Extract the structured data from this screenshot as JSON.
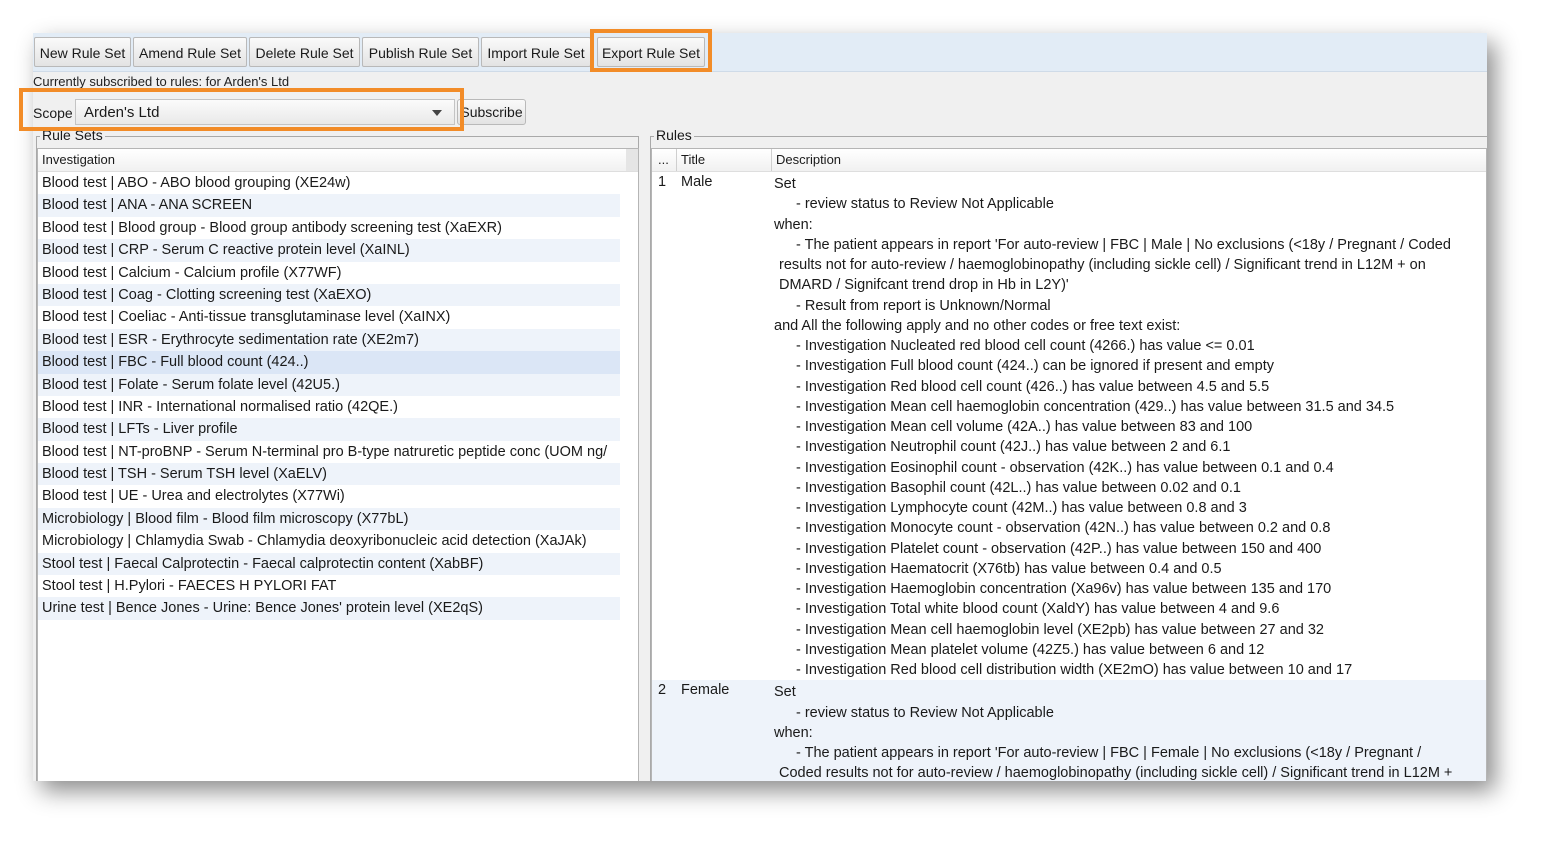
{
  "toolbar": {
    "buttons": [
      "New Rule Set",
      "Amend Rule Set",
      "Delete Rule Set",
      "Publish Rule Set",
      "Import Rule Set",
      "Export Rule Set"
    ]
  },
  "subscription": {
    "text": "Currently subscribed to rules: for  Arden's Ltd"
  },
  "scope": {
    "label": "Scope",
    "value": "Arden's Ltd",
    "subscribe_label": "Subscribe"
  },
  "rule_sets": {
    "group_title": "Rule Sets",
    "column_header": "Investigation",
    "items": [
      "Blood test | ABO - ABO blood grouping (XE24w)",
      "Blood test | ANA - ANA SCREEN",
      "Blood test | Blood group - Blood group antibody screening test (XaEXR)",
      "Blood test | CRP - Serum C reactive protein level (XaINL)",
      "Blood test | Calcium - Calcium profile (X77WF)",
      "Blood test | Coag - Clotting screening test (XaEXO)",
      "Blood test | Coeliac - Anti-tissue transglutaminase level (XaINX)",
      "Blood test | ESR - Erythrocyte sedimentation rate (XE2m7)",
      "Blood test | FBC - Full blood count (424..)",
      "Blood test | Folate - Serum folate level (42U5.)",
      "Blood test | INR - International normalised ratio (42QE.)",
      "Blood test | LFTs - Liver profile",
      "Blood test | NT-proBNP - Serum N-terminal pro B-type natruretic peptide conc (UOM ng/",
      "Blood test | TSH - Serum TSH level (XaELV)",
      "Blood test | UE - Urea and electrolytes (X77Wi)",
      "Microbiology | Blood film - Blood film microscopy (X77bL)",
      "Microbiology | Chlamydia Swab - Chlamydia deoxyribonucleic acid detection (XaJAk)",
      "Stool test | Faecal Calprotectin - Faecal calprotectin content (XabBF)",
      "Stool test | H.Pylori - FAECES H PYLORI FAT",
      "Urine test | Bence Jones - Urine: Bence Jones' protein level (XE2qS)"
    ],
    "selected_index": 8
  },
  "rules": {
    "group_title": "Rules",
    "columns": [
      "...",
      "Title",
      "Description"
    ],
    "rows": [
      {
        "num": "1",
        "title": "Male",
        "description": [
          {
            "text": "Set",
            "indent": 0
          },
          {
            "text": "- review status to Review Not Applicable",
            "indent": 1
          },
          {
            "text": "when:",
            "indent": 0
          },
          {
            "text": "- The patient appears in report 'For auto-review | FBC | Male | No exclusions (<18y / Pregnant / Coded",
            "indent": 1
          },
          {
            "text": "results not for auto-review / haemoglobinopathy (including sickle cell) / Significant trend in L12M + on",
            "indent": 2
          },
          {
            "text": "DMARD / Signifcant trend drop in Hb in L2Y)'",
            "indent": 2
          },
          {
            "text": "- Result from report is Unknown/Normal",
            "indent": 1
          },
          {
            "text": "and All the following apply and no other codes or free text exist:",
            "indent": 0
          },
          {
            "text": "- Investigation Nucleated red blood cell count (4266.) has value <= 0.01",
            "indent": 1
          },
          {
            "text": "- Investigation Full blood count (424..) can be ignored if present and empty",
            "indent": 1
          },
          {
            "text": "- Investigation Red blood cell count (426..) has value between 4.5 and 5.5",
            "indent": 1
          },
          {
            "text": "- Investigation Mean cell haemoglobin concentration (429..) has value between 31.5 and 34.5",
            "indent": 1
          },
          {
            "text": "- Investigation Mean cell volume (42A..) has value between 83 and 100",
            "indent": 1
          },
          {
            "text": "- Investigation Neutrophil count (42J..) has value between 2 and 6.1",
            "indent": 1
          },
          {
            "text": "- Investigation Eosinophil count - observation (42K..) has value between 0.1 and 0.4",
            "indent": 1
          },
          {
            "text": "- Investigation Basophil count (42L..) has value between 0.02 and 0.1",
            "indent": 1
          },
          {
            "text": "- Investigation Lymphocyte count (42M..) has value between 0.8 and 3",
            "indent": 1
          },
          {
            "text": "- Investigation Monocyte count - observation (42N..) has value between 0.2 and 0.8",
            "indent": 1
          },
          {
            "text": "- Investigation Platelet count - observation (42P..) has value between 150 and 400",
            "indent": 1
          },
          {
            "text": "- Investigation Haematocrit (X76tb) has value between 0.4 and 0.5",
            "indent": 1
          },
          {
            "text": "- Investigation Haemoglobin concentration (Xa96v) has value between 135 and 170",
            "indent": 1
          },
          {
            "text": "- Investigation Total white blood count (XaldY) has value between 4 and 9.6",
            "indent": 1
          },
          {
            "text": "- Investigation Mean cell haemoglobin level (XE2pb) has value between 27 and 32",
            "indent": 1
          },
          {
            "text": "- Investigation Mean platelet volume (42Z5.) has value between 6 and 12",
            "indent": 1
          },
          {
            "text": "- Investigation Red blood cell distribution width (XE2mO) has value between 10 and 17",
            "indent": 1
          }
        ]
      },
      {
        "num": "2",
        "title": "Female",
        "description": [
          {
            "text": "Set",
            "indent": 0
          },
          {
            "text": "- review status to Review Not Applicable",
            "indent": 1
          },
          {
            "text": "when:",
            "indent": 0
          },
          {
            "text": "- The patient appears in report 'For auto-review | FBC | Female | No exclusions (<18y / Pregnant /",
            "indent": 1
          },
          {
            "text": "Coded results not for auto-review / haemoglobinopathy (including sickle cell) / Significant trend in L12M +",
            "indent": 2
          }
        ]
      }
    ]
  },
  "highlight_color": "#f28c28"
}
